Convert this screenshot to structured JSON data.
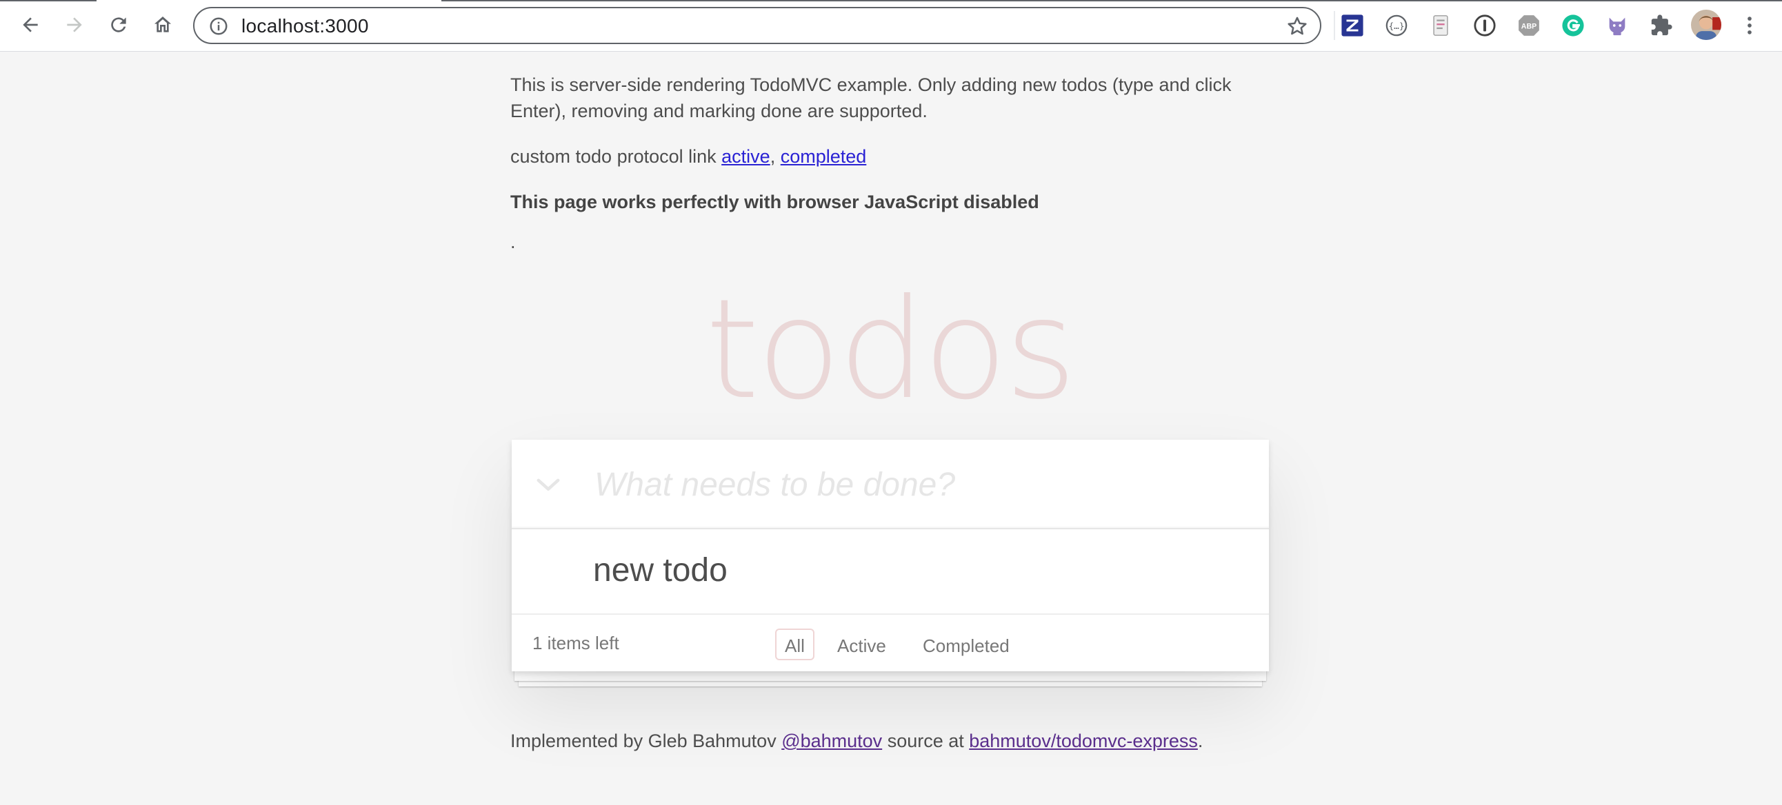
{
  "browser": {
    "url": "localhost:3000",
    "extensions": [
      "zotero-icon",
      "json-formatter-icon",
      "document-icon",
      "password-manager-icon",
      "adblock-plus-icon",
      "grammarly-icon",
      "cat-extension-icon",
      "puzzle-icon"
    ],
    "colors": {
      "zotero": "#283593",
      "grammarly": "#15c39a",
      "adblock": "#9e9e9e"
    }
  },
  "intro": {
    "text": "This is server-side rendering TodoMVC example. Only adding new todos (type and click Enter), removing and marking done are supported.",
    "protocol_prefix": "custom todo protocol link ",
    "link_active": "active",
    "separator": ", ",
    "link_completed": "completed",
    "js_note": "This page works perfectly with browser JavaScript disabled",
    "dot": "."
  },
  "app": {
    "title": "todos",
    "new_todo_placeholder": "What needs to be done?",
    "new_todo_value": "",
    "todos": [
      {
        "title": "new todo",
        "completed": false
      }
    ],
    "footer": {
      "count": "1 items left",
      "filters": [
        "All",
        "Active",
        "Completed"
      ],
      "selected_filter": "All"
    }
  },
  "info": {
    "prefix": "Implemented by Gleb Bahmutov ",
    "author_link": "@bahmutov",
    "middle": " source at ",
    "repo_link": "bahmutov/todomvc-express",
    "suffix": "."
  }
}
